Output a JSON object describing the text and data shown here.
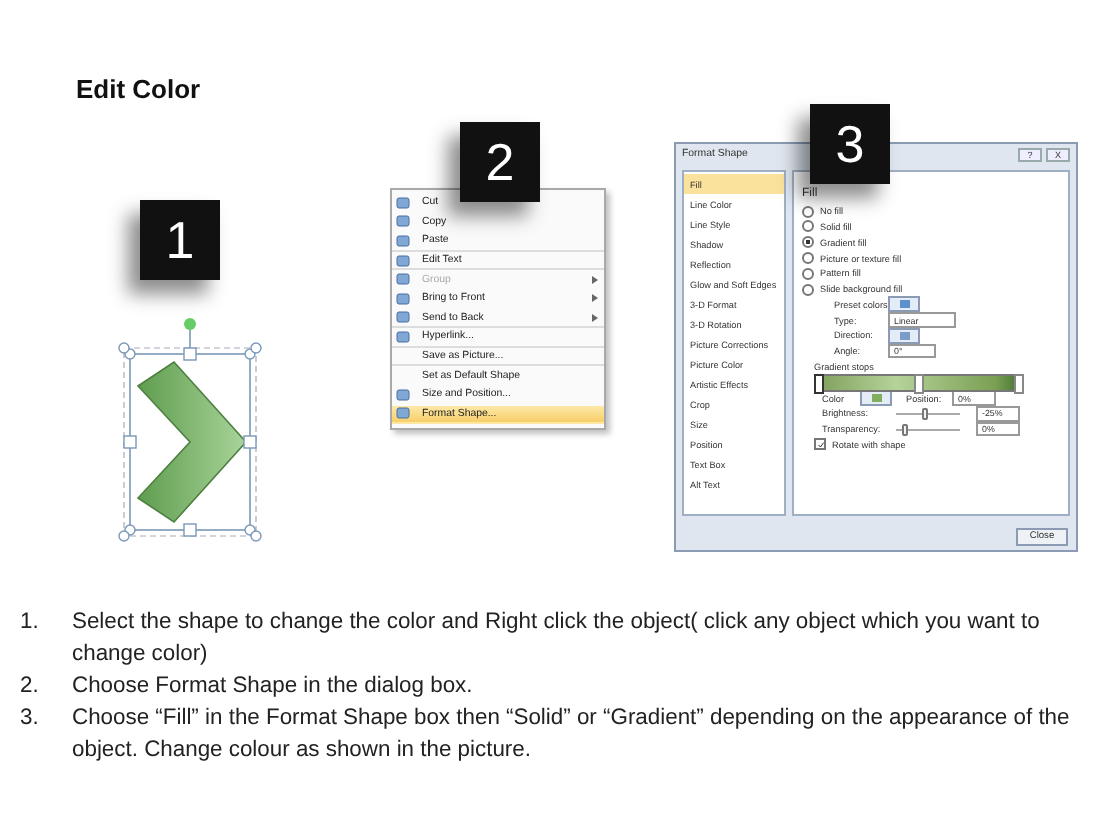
{
  "title": "Edit Color",
  "badges": [
    {
      "number": "1"
    },
    {
      "number": "2"
    },
    {
      "number": "3"
    }
  ],
  "context_menu": {
    "items": [
      {
        "label": "Cut",
        "icon": true,
        "disabled": false,
        "submenu": false,
        "selected": false,
        "separator_after": false
      },
      {
        "label": "Copy",
        "icon": true,
        "disabled": false,
        "submenu": false,
        "selected": false,
        "separator_after": false
      },
      {
        "label": "Paste",
        "icon": true,
        "disabled": false,
        "submenu": false,
        "selected": false,
        "separator_after": true
      },
      {
        "label": "Edit Text",
        "icon": true,
        "disabled": false,
        "submenu": false,
        "selected": false,
        "separator_after": true
      },
      {
        "label": "Group",
        "icon": true,
        "disabled": true,
        "submenu": true,
        "selected": false,
        "separator_after": false
      },
      {
        "label": "Bring to Front",
        "icon": true,
        "disabled": false,
        "submenu": true,
        "selected": false,
        "separator_after": false
      },
      {
        "label": "Send to Back",
        "icon": true,
        "disabled": false,
        "submenu": true,
        "selected": false,
        "separator_after": true
      },
      {
        "label": "Hyperlink...",
        "icon": true,
        "disabled": false,
        "submenu": false,
        "selected": false,
        "separator_after": true
      },
      {
        "label": "Save as Picture...",
        "icon": false,
        "disabled": false,
        "submenu": false,
        "selected": false,
        "separator_after": true
      },
      {
        "label": "Set as Default Shape",
        "icon": false,
        "disabled": false,
        "submenu": false,
        "selected": false,
        "separator_after": false
      },
      {
        "label": "Size and Position...",
        "icon": true,
        "disabled": false,
        "submenu": false,
        "selected": false,
        "separator_after": false
      },
      {
        "label": "Format Shape...",
        "icon": true,
        "disabled": false,
        "submenu": false,
        "selected": true,
        "separator_after": false
      }
    ]
  },
  "dialog": {
    "title": "Format Shape",
    "help": "?",
    "close_glyph": "X",
    "categories": [
      {
        "label": "Fill",
        "selected": true
      },
      {
        "label": "Line Color",
        "selected": false
      },
      {
        "label": "Line Style",
        "selected": false
      },
      {
        "label": "Shadow",
        "selected": false
      },
      {
        "label": "Reflection",
        "selected": false
      },
      {
        "label": "Glow and Soft Edges",
        "selected": false
      },
      {
        "label": "3-D Format",
        "selected": false
      },
      {
        "label": "3-D Rotation",
        "selected": false
      },
      {
        "label": "Picture Corrections",
        "selected": false
      },
      {
        "label": "Picture Color",
        "selected": false
      },
      {
        "label": "Artistic Effects",
        "selected": false
      },
      {
        "label": "Crop",
        "selected": false
      },
      {
        "label": "Size",
        "selected": false
      },
      {
        "label": "Position",
        "selected": false
      },
      {
        "label": "Text Box",
        "selected": false
      },
      {
        "label": "Alt Text",
        "selected": false
      }
    ],
    "heading": "Fill",
    "fill_options": [
      {
        "label": "No fill",
        "selected": false
      },
      {
        "label": "Solid fill",
        "selected": false
      },
      {
        "label": "Gradient fill",
        "selected": true
      },
      {
        "label": "Picture or texture fill",
        "selected": false
      },
      {
        "label": "Pattern fill",
        "selected": false
      },
      {
        "label": "Slide background fill",
        "selected": false
      }
    ],
    "preset_colors_label": "Preset colors:",
    "type": {
      "label": "Type:",
      "value": "Linear"
    },
    "direction_label": "Direction:",
    "angle": {
      "label": "Angle:",
      "value": "0°"
    },
    "gradient_stops_label": "Gradient stops",
    "stops": [
      {
        "level": 0,
        "selected": true
      },
      {
        "level": 0.5,
        "selected": false
      },
      {
        "level": 1,
        "selected": false
      }
    ],
    "color_label": "Color",
    "position": {
      "label": "Position:",
      "value": "0%"
    },
    "brightness": {
      "label": "Brightness:",
      "level": 0.45,
      "value": "-25%"
    },
    "transparency": {
      "label": "Transparency:",
      "level": 0.1,
      "value": "0%"
    },
    "rotate": {
      "label": "Rotate with shape",
      "checked": true
    },
    "close_button": "Close"
  },
  "instructions": [
    {
      "number": "1.",
      "text": "Select the shape to change the color and Right click the object( click any object which you want to change color)"
    },
    {
      "number": "2.",
      "text": "Choose Format Shape in the dialog box."
    },
    {
      "number": "3.",
      "text": "Choose “Fill” in the Format Shape box then “Solid” or “Gradient” depending on the appearance of the object. Change colour as shown in the picture."
    }
  ]
}
